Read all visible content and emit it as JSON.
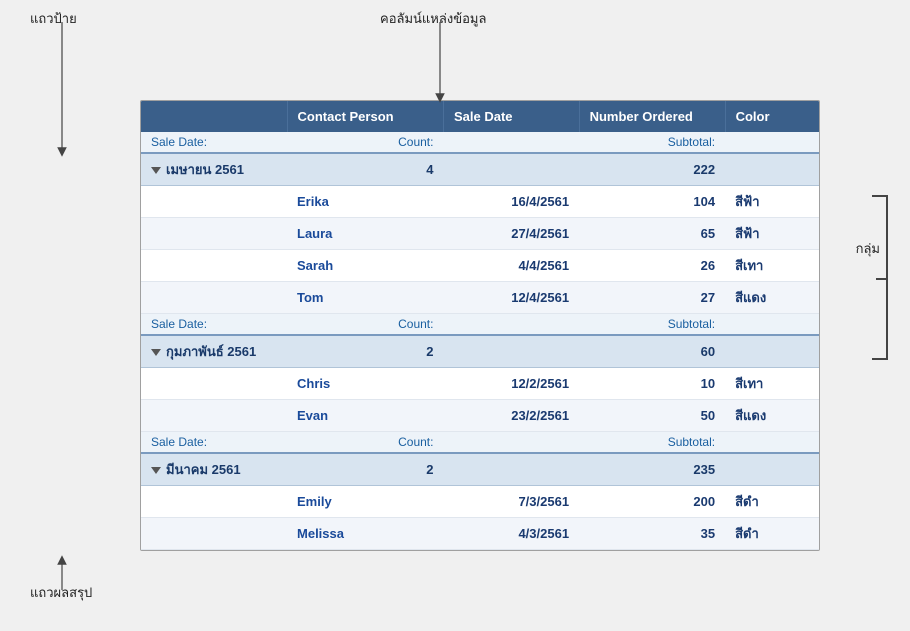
{
  "annotations": {
    "tag_label": "แถวป้าย",
    "col_label": "คอลัมน์แหล่งข้อมูล",
    "group_label": "กลุ่ม",
    "summary_label": "แถวผลสรุป"
  },
  "header": {
    "col1": "Contact Person",
    "col2": "Sale Date",
    "col3": "Number Ordered",
    "col4": "Color"
  },
  "groups": [
    {
      "name": "เมษายน 2561",
      "count": "4",
      "subtotal": "222",
      "rows": [
        {
          "name": "Erika",
          "date": "16/4/2561",
          "qty": "104",
          "color": "สีฟ้า"
        },
        {
          "name": "Laura",
          "date": "27/4/2561",
          "qty": "65",
          "color": "สีฟ้า"
        },
        {
          "name": "Sarah",
          "date": "4/4/2561",
          "qty": "26",
          "color": "สีเทา"
        },
        {
          "name": "Tom",
          "date": "12/4/2561",
          "qty": "27",
          "color": "สีแดง"
        }
      ]
    },
    {
      "name": "กุมภาพันธ์ 2561",
      "count": "2",
      "subtotal": "60",
      "rows": [
        {
          "name": "Chris",
          "date": "12/2/2561",
          "qty": "10",
          "color": "สีเทา"
        },
        {
          "name": "Evan",
          "date": "23/2/2561",
          "qty": "50",
          "color": "สีแดง"
        }
      ]
    },
    {
      "name": "มีนาคม 2561",
      "count": "2",
      "subtotal": "235",
      "rows": [
        {
          "name": "Emily",
          "date": "7/3/2561",
          "qty": "200",
          "color": "สีดำ"
        },
        {
          "name": "Melissa",
          "date": "4/3/2561",
          "qty": "35",
          "color": "สีดำ"
        }
      ]
    }
  ],
  "subheader": {
    "sale_date_label": "Sale Date:",
    "count_label": "Count:",
    "subtotal_label": "Subtotal:"
  }
}
